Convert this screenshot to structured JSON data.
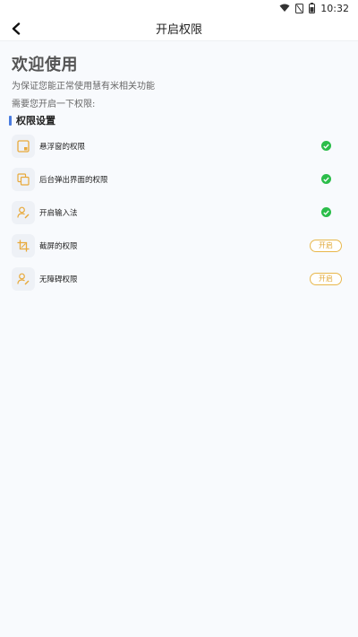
{
  "status_bar": {
    "time": "10:32",
    "icons": [
      "wifi-icon",
      "sim-off-icon",
      "battery-icon"
    ]
  },
  "nav": {
    "title": "开启权限",
    "back_icon": "chevron-left-icon"
  },
  "intro": {
    "headline": "欢迎使用",
    "subtitle": "为保证您能正常使用慧有米相关功能",
    "prompt": "需要您开启一下权限:"
  },
  "section": {
    "title": "权限设置"
  },
  "permissions": [
    {
      "label": "悬浮窗的权限",
      "icon": "floating-window-icon",
      "status": "granted"
    },
    {
      "label": "后台弹出界面的权限",
      "icon": "popup-window-icon",
      "status": "granted"
    },
    {
      "label": "开启输入法",
      "icon": "user-edit-icon",
      "status": "granted"
    },
    {
      "label": "截屏的权限",
      "icon": "crop-icon",
      "status": "pending",
      "action_label": "开启"
    },
    {
      "label": "无障碍权限",
      "icon": "accessibility-user-icon",
      "status": "pending",
      "action_label": "开启"
    }
  ],
  "colors": {
    "accent": "#4a7ce0",
    "granted": "#2bbd4a",
    "action": "#e0a838"
  }
}
